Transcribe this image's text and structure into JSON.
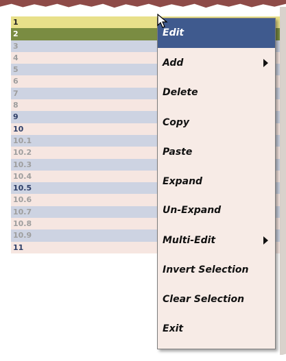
{
  "rows": [
    {
      "label": "1",
      "style": "sel-yellow"
    },
    {
      "label": "2",
      "style": "sel-green"
    },
    {
      "label": "3",
      "style": "alt"
    },
    {
      "label": "4",
      "style": "base"
    },
    {
      "label": "5",
      "style": "alt"
    },
    {
      "label": "6",
      "style": "base"
    },
    {
      "label": "7",
      "style": "alt"
    },
    {
      "label": "8",
      "style": "base"
    },
    {
      "label": "9",
      "style": "alt dark"
    },
    {
      "label": "10",
      "style": "base dark"
    },
    {
      "label": "10.1",
      "style": "alt"
    },
    {
      "label": "10.2",
      "style": "base"
    },
    {
      "label": "10.3",
      "style": "alt"
    },
    {
      "label": "10.4",
      "style": "base"
    },
    {
      "label": "10.5",
      "style": "alt dark"
    },
    {
      "label": "10.6",
      "style": "base"
    },
    {
      "label": "10.7",
      "style": "alt"
    },
    {
      "label": "10.8",
      "style": "base"
    },
    {
      "label": "10.9",
      "style": "alt"
    },
    {
      "label": "11",
      "style": "base dark"
    }
  ],
  "context_menu": {
    "items": [
      {
        "label": "Edit",
        "active": true,
        "submenu": false
      },
      {
        "label": "Add",
        "active": false,
        "submenu": true
      },
      {
        "label": "Delete",
        "active": false,
        "submenu": false
      },
      {
        "label": "Copy",
        "active": false,
        "submenu": false
      },
      {
        "label": "Paste",
        "active": false,
        "submenu": false
      },
      {
        "label": "Expand",
        "active": false,
        "submenu": false
      },
      {
        "label": "Un-Expand",
        "active": false,
        "submenu": false
      },
      {
        "label": "Multi-Edit",
        "active": false,
        "submenu": true
      },
      {
        "label": "Invert Selection",
        "active": false,
        "submenu": false
      },
      {
        "label": "Clear Selection",
        "active": false,
        "submenu": false
      },
      {
        "label": "Exit",
        "active": false,
        "submenu": false
      }
    ]
  },
  "colors": {
    "menu_highlight": "#3f5a8e",
    "row_selected_yellow": "#e8e08a",
    "row_selected_green": "#7a8c42",
    "row_alt": "#cdd3e2",
    "row_base": "#f6e6e1"
  },
  "icons": {
    "cursor": "mouse-pointer-icon",
    "submenu": "submenu-arrow-icon"
  }
}
